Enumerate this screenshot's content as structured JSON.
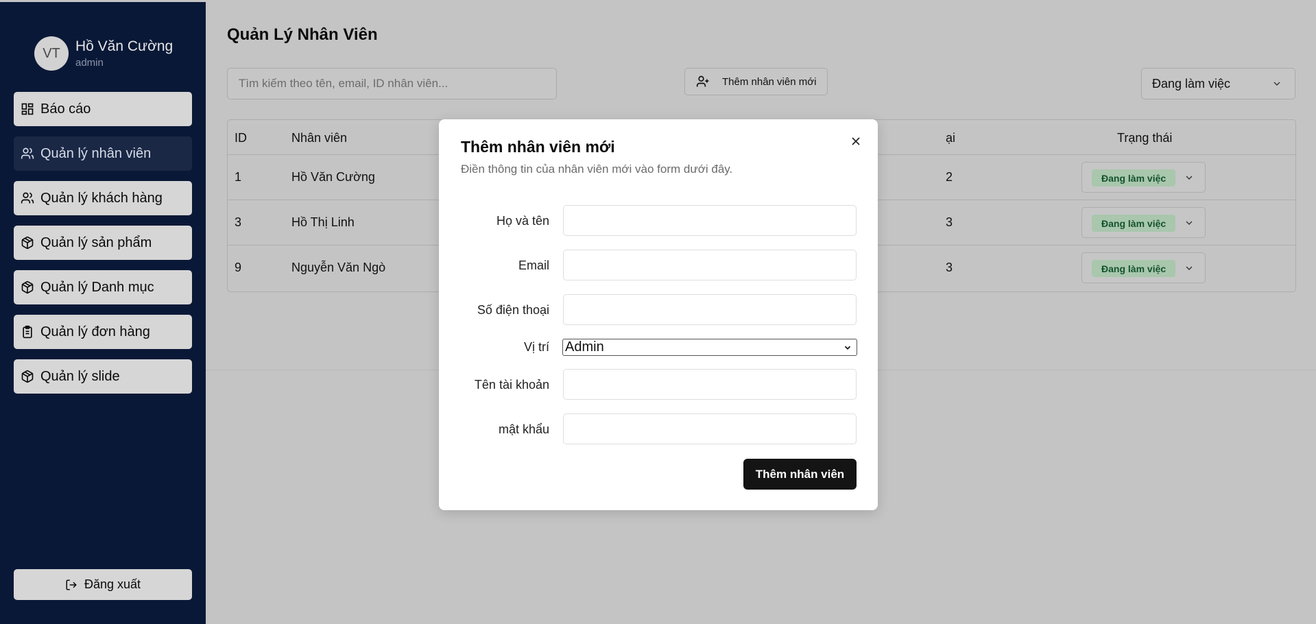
{
  "user": {
    "initials": "VT",
    "name": "Hồ Văn Cường",
    "role": "admin"
  },
  "sidebar": {
    "items": [
      {
        "label": "Báo cáo",
        "icon": "dashboard-icon"
      },
      {
        "label": "Quản lý nhân viên",
        "icon": "users-icon"
      },
      {
        "label": "Quản lý khách hàng",
        "icon": "users-icon"
      },
      {
        "label": "Quản lý sản phẩm",
        "icon": "package-icon"
      },
      {
        "label": "Quản lý Danh mục",
        "icon": "package-icon"
      },
      {
        "label": "Quản lý đơn hàng",
        "icon": "clipboard-icon"
      },
      {
        "label": "Quản lý slide",
        "icon": "package-icon"
      }
    ],
    "active_index": 1,
    "logout_label": "Đăng xuất"
  },
  "main": {
    "title": "Quản Lý Nhân Viên",
    "search_placeholder": "Tìm kiếm theo tên, email, ID nhân viên...",
    "add_button_label": "Thêm nhân viên mới",
    "filter_value": "Đang làm việc",
    "table": {
      "headers": {
        "id": "ID",
        "employee": "Nhân viên",
        "phone_partial": "ại",
        "status": "Trạng thái"
      },
      "rows": [
        {
          "id": "1",
          "name": "Hồ Văn Cường",
          "phone_partial": "2",
          "status": "Đang làm việc"
        },
        {
          "id": "3",
          "name": "Hồ Thị Linh",
          "phone_partial": "3",
          "status": "Đang làm việc"
        },
        {
          "id": "9",
          "name": "Nguyễn Văn Ngò",
          "phone_partial": "3",
          "status": "Đang làm việc"
        }
      ]
    }
  },
  "modal": {
    "title": "Thêm nhân viên mới",
    "description": "Điền thông tin của nhân viên mới vào form dưới đây.",
    "fields": {
      "fullname_label": "Họ và tên",
      "email_label": "Email",
      "phone_label": "Số điện thoại",
      "position_label": "Vị trí",
      "position_value": "Admin",
      "username_label": "Tên tài khoản",
      "password_label": "mật khẩu"
    },
    "submit_label": "Thêm nhân viên"
  },
  "colors": {
    "sidebar_bg": "#0a1837",
    "overlay_bg": "#c4c4c4",
    "badge_bg": "#a9c7ad",
    "badge_text": "#14532d",
    "primary_button": "#141414"
  }
}
